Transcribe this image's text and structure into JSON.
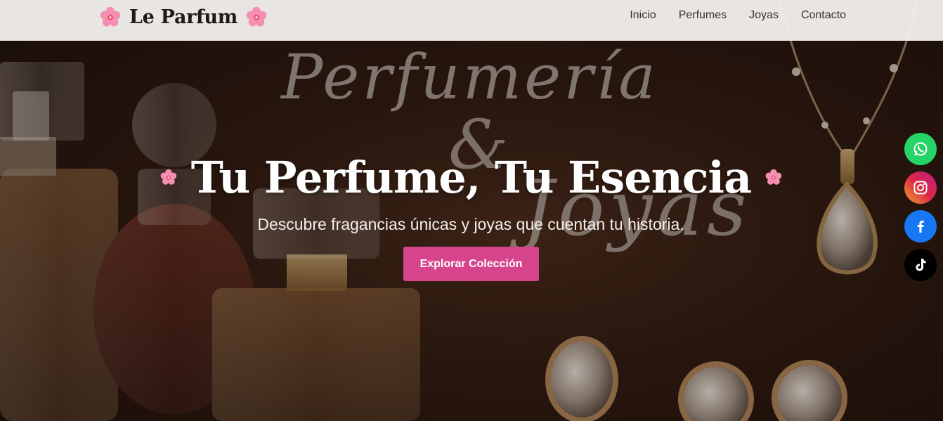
{
  "navbar": {
    "brand": "Le Parfum",
    "links": [
      "Inicio",
      "Perfumes",
      "Joyas",
      "Contacto"
    ]
  },
  "hero": {
    "script_line1": "Perfumería",
    "script_amp": "&",
    "script_line2": "Joyas",
    "title": "Tu Perfume, Tu Esencia",
    "subtitle": "Descubre fragancias únicas y joyas que cuentan tu historia.",
    "cta": "Explorar Colección"
  },
  "social": [
    {
      "name": "whatsapp-icon",
      "color": "#25d366"
    },
    {
      "name": "instagram-icon",
      "color": "#dc2743"
    },
    {
      "name": "facebook-icon",
      "color": "#1877f2"
    },
    {
      "name": "tiktok-icon",
      "color": "#000000"
    }
  ],
  "colors": {
    "accent": "#d6448b",
    "navbar_bg": "#f0eeec",
    "hero_dark": "#2e1a10"
  }
}
